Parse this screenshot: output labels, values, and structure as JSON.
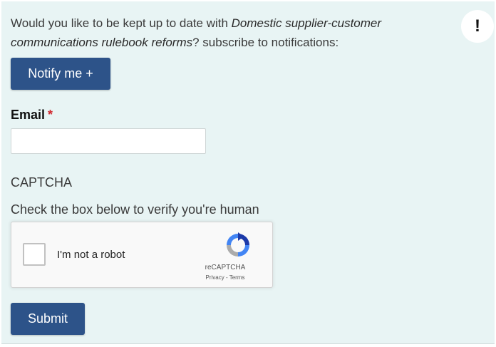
{
  "subscribe": {
    "intro_prefix": "Would you like to be kept up to date with ",
    "intro_topic": "Domestic supplier-customer communications rulebook reforms",
    "intro_suffix": "? subscribe to notifications:",
    "alert_symbol": "!",
    "notify_label": "Notify me +"
  },
  "email": {
    "label": "Email",
    "required_marker": "*",
    "value": "",
    "placeholder": ""
  },
  "captcha": {
    "heading": "CAPTCHA",
    "help_text": "Check the box below to verify you're human",
    "checkbox_label": "I'm not a robot",
    "checked": false,
    "brand": "reCAPTCHA",
    "privacy_label": "Privacy",
    "separator": " - ",
    "terms_label": "Terms",
    "logo_icon": "recaptcha-logo-icon"
  },
  "form": {
    "submit_label": "Submit"
  },
  "colors": {
    "panel_background": "#e8f4f4",
    "button_background": "#2d5389",
    "required_color": "#d0282e"
  }
}
